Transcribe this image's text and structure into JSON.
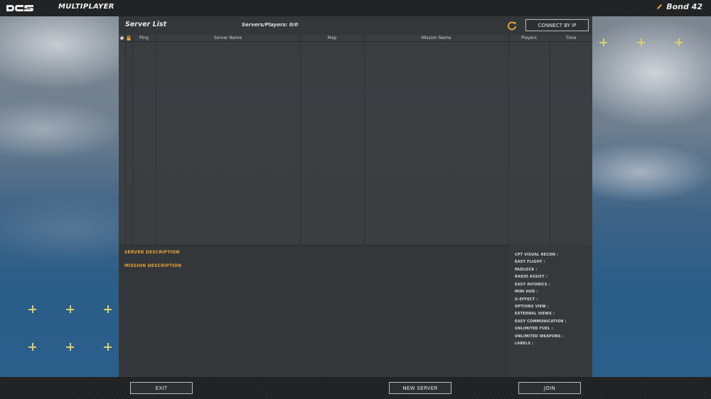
{
  "topbar": {
    "logo_text": "DCS",
    "title": "MULTIPLAYER",
    "username": "Bond 42"
  },
  "panel": {
    "title": "Server List",
    "count": "Servers/Players: 0/0",
    "connect_ip_label": "CONNECT BY IP",
    "columns": [
      "Ping",
      "Server Name",
      "Map",
      "Mission Name",
      "Players",
      "Time"
    ],
    "server_description_label": "SERVER DESCRIPTION",
    "mission_description_label": "MISSION DESCRIPTION",
    "settings": [
      "CPT VISUAL RECON :",
      "EASY FLIGHT :",
      "PADLOCK :",
      "RADIO ASSIST :",
      "EASY AVIONICS :",
      "MINI HUD :",
      "G-EFFECT :",
      "OPTIONS VIEW :",
      "EXTERNAL VIEWS :",
      "EASY COMMUNICATION :",
      "UNLIMITED FUEL :",
      "UNLIMITED WEAPONS :",
      "LABELS :"
    ]
  },
  "bottombar": {
    "exit_label": "EXIT",
    "new_server_label": "NEW SERVER",
    "join_label": "JOIN"
  },
  "colors": {
    "accent": "#e0a23a",
    "marker": "#d9cf6f",
    "panel_bg": "#343739"
  }
}
